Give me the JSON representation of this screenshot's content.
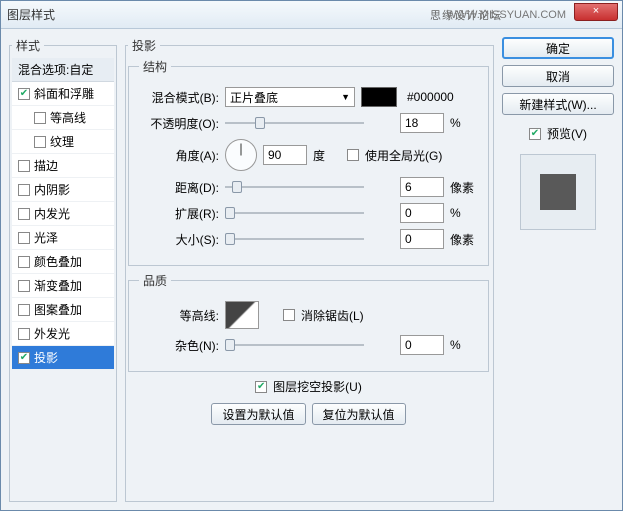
{
  "window": {
    "title": "图层样式",
    "watermark1": "思缘设计论坛",
    "watermark2": "WWW.MISSYUAN.COM",
    "close": "×"
  },
  "sidebar": {
    "legend": "样式",
    "header": "混合选项:自定",
    "items": [
      {
        "label": "斜面和浮雕",
        "checked": true,
        "sub": false
      },
      {
        "label": "等高线",
        "checked": false,
        "sub": true
      },
      {
        "label": "纹理",
        "checked": false,
        "sub": true
      },
      {
        "label": "描边",
        "checked": false,
        "sub": false
      },
      {
        "label": "内阴影",
        "checked": false,
        "sub": false
      },
      {
        "label": "内发光",
        "checked": false,
        "sub": false
      },
      {
        "label": "光泽",
        "checked": false,
        "sub": false
      },
      {
        "label": "颜色叠加",
        "checked": false,
        "sub": false
      },
      {
        "label": "渐变叠加",
        "checked": false,
        "sub": false
      },
      {
        "label": "图案叠加",
        "checked": false,
        "sub": false
      },
      {
        "label": "外发光",
        "checked": false,
        "sub": false
      },
      {
        "label": "投影",
        "checked": true,
        "sub": false,
        "selected": true
      }
    ]
  },
  "main": {
    "legend": "投影",
    "structure": {
      "legend": "结构",
      "blend_label": "混合模式(B):",
      "blend_value": "正片叠底",
      "hex": "#000000",
      "opacity_label": "不透明度(O):",
      "opacity_value": "18",
      "opacity_unit": "%",
      "angle_label": "角度(A):",
      "angle_value": "90",
      "angle_unit": "度",
      "global_light": "使用全局光(G)",
      "distance_label": "距离(D):",
      "distance_value": "6",
      "distance_unit": "像素",
      "spread_label": "扩展(R):",
      "spread_value": "0",
      "spread_unit": "%",
      "size_label": "大小(S):",
      "size_value": "0",
      "size_unit": "像素"
    },
    "quality": {
      "legend": "品质",
      "contour_label": "等高线:",
      "antialias": "消除锯齿(L)",
      "noise_label": "杂色(N):",
      "noise_value": "0",
      "noise_unit": "%"
    },
    "knockout": "图层挖空投影(U)",
    "make_default": "设置为默认值",
    "reset_default": "复位为默认值"
  },
  "right": {
    "ok": "确定",
    "cancel": "取消",
    "new_style": "新建样式(W)...",
    "preview": "预览(V)"
  }
}
